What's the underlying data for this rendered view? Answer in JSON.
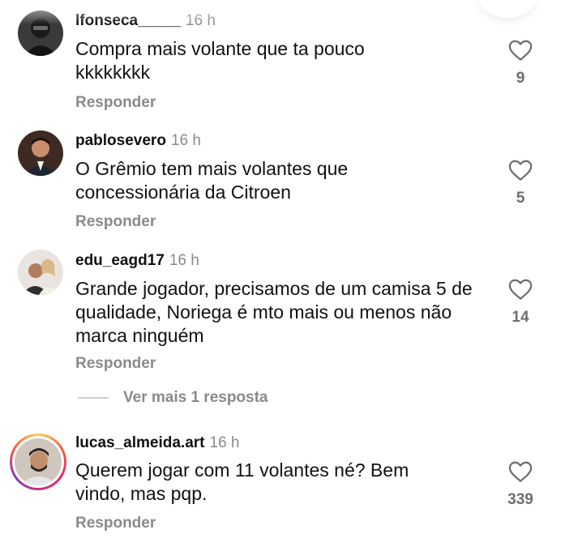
{
  "comments": [
    {
      "username": "lfonseca_____",
      "time": "16 h",
      "text": "Compra mais volante que ta pouco kkkkkkkk",
      "reply": "Responder",
      "likes": "9",
      "avatar_icon": "masked-person-avatar"
    },
    {
      "username": "pablosevero",
      "time": "16 h",
      "text": "O Grêmio tem mais volantes que concessionária da Citroen",
      "reply": "Responder",
      "likes": "5",
      "avatar_icon": "man-in-suit-avatar"
    },
    {
      "username": "edu_eagd17",
      "time": "16 h",
      "text": "Grande jogador, precisamos de um camisa 5 de qualidade, Noriega é mto mais ou menos não marca ninguém",
      "reply": "Responder",
      "likes": "14",
      "avatar_icon": "couple-avatar"
    },
    {
      "username": "lucas_almeida.art",
      "time": "16 h",
      "text": "Querem jogar com 11 volantes né? Bem vindo, mas pqp.",
      "reply": "Responder",
      "likes": "339",
      "avatar_icon": "man-with-cap-avatar"
    }
  ],
  "view_more_replies": "Ver mais 1 resposta",
  "like_icon": "heart-outline-icon",
  "story_ring_colors": [
    "#fdcb52",
    "#f56040",
    "#e1306c",
    "#c13584",
    "#833ab4"
  ]
}
